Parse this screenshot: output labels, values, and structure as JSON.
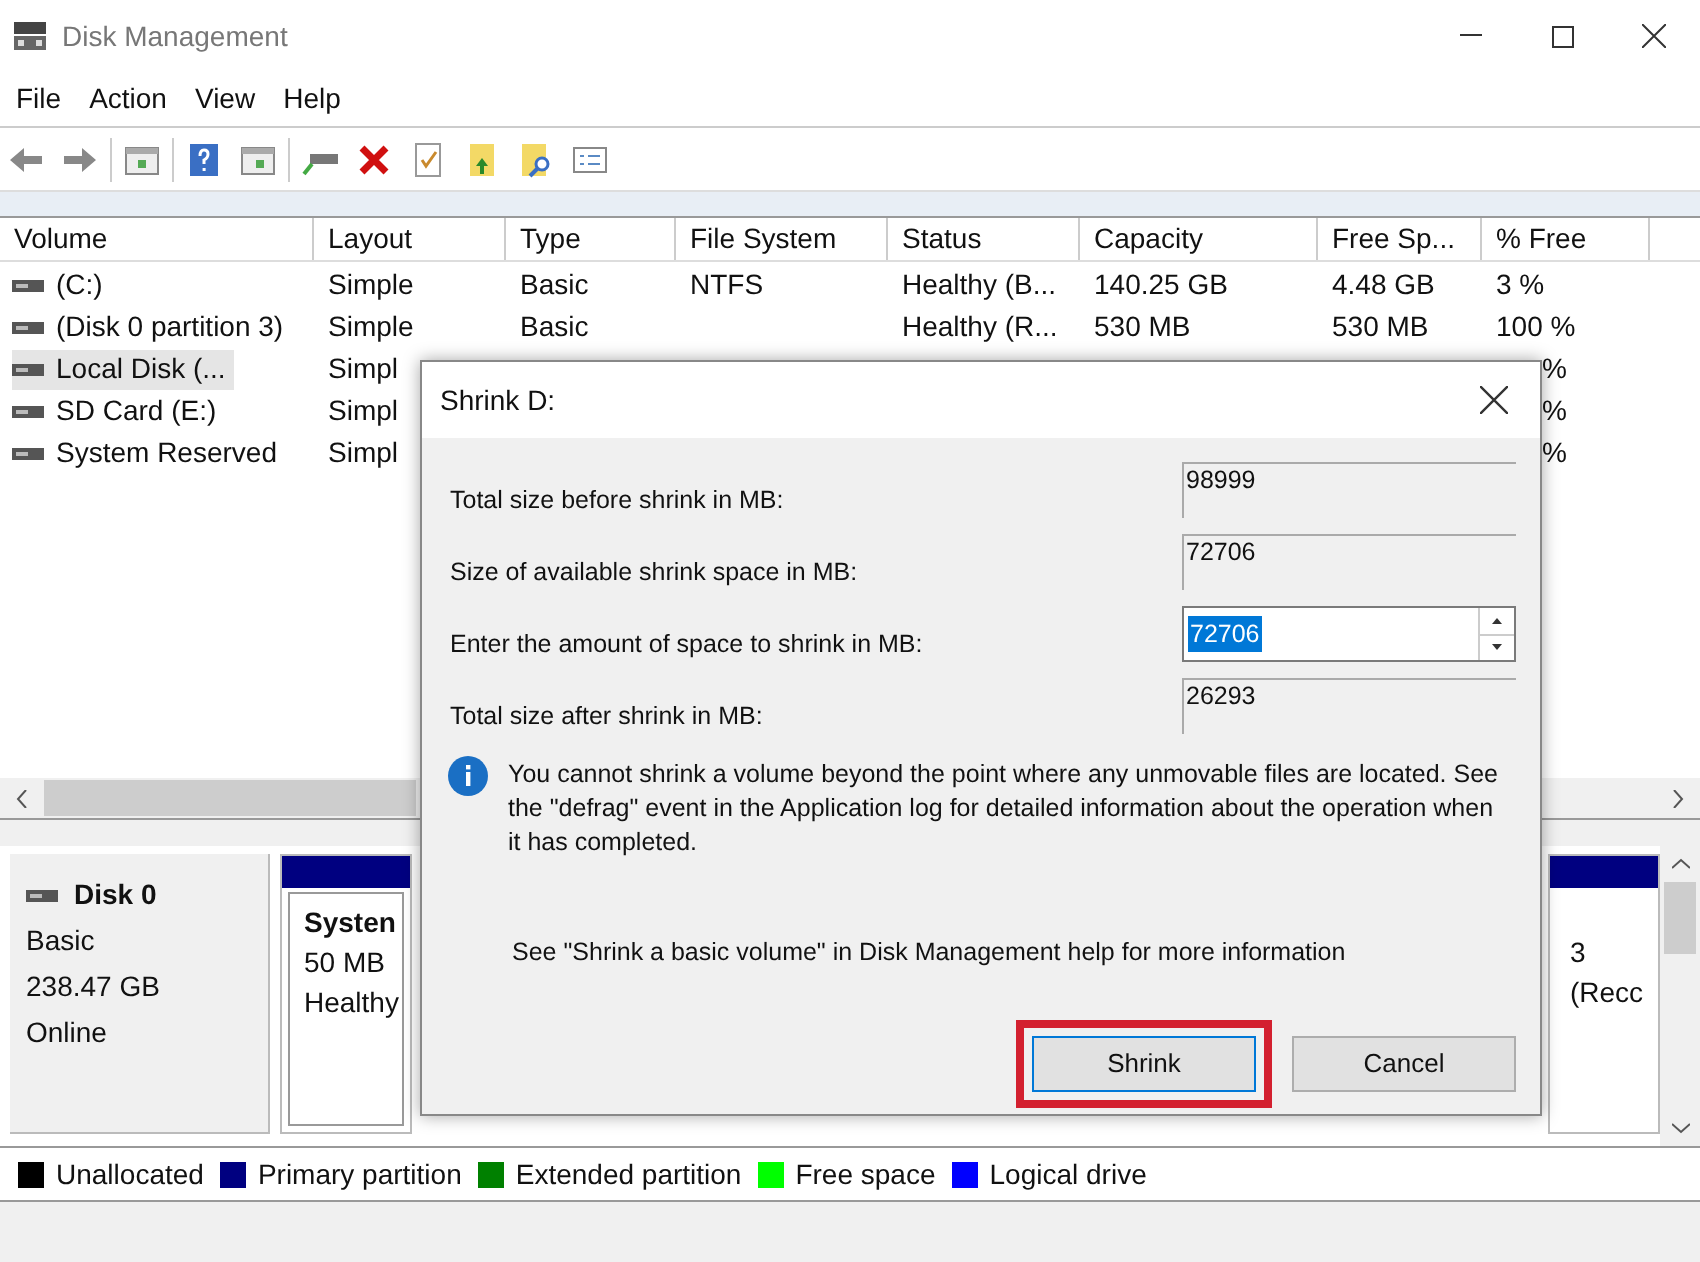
{
  "window": {
    "title": "Disk Management"
  },
  "menu": [
    "File",
    "Action",
    "View",
    "Help"
  ],
  "volumes": {
    "columns": [
      "Volume",
      "Layout",
      "Type",
      "File System",
      "Status",
      "Capacity",
      "Free Sp...",
      "% Free"
    ],
    "rows": [
      {
        "volume": "(C:)",
        "layout": "Simple",
        "type": "Basic",
        "file_system": "NTFS",
        "status": "Healthy (B...",
        "capacity": "140.25 GB",
        "free_space": "4.48 GB",
        "percent_free": "3 %",
        "selected": false
      },
      {
        "volume": "(Disk 0 partition 3)",
        "layout": "Simple",
        "type": "Basic",
        "status": "Healthy (R...",
        "capacity": "530 MB",
        "free_space": "530 MB",
        "percent_free": "100 %",
        "selected": false
      },
      {
        "volume": "Local Disk (...",
        "layout": "Simpl",
        "percent_free": "%",
        "selected": true,
        "partly_hidden": true
      },
      {
        "volume": "SD Card (E:)",
        "layout": "Simpl",
        "percent_free": "%",
        "selected": false,
        "partly_hidden": true
      },
      {
        "volume": "System Reserved",
        "layout": "Simpl",
        "percent_free": "%",
        "selected": false,
        "partly_hidden": true
      }
    ]
  },
  "disk": {
    "name": "Disk 0",
    "type": "Basic",
    "size": "238.47 GB",
    "status": "Online",
    "partitions": [
      {
        "lines": [
          "Systen",
          "50 MB",
          "Healthy"
        ]
      },
      {
        "lines": [
          "3",
          "(Recc"
        ]
      }
    ]
  },
  "legend": [
    {
      "label": "Unallocated",
      "color": "#000000"
    },
    {
      "label": "Primary partition",
      "color": "#000080"
    },
    {
      "label": "Extended partition",
      "color": "#008000"
    },
    {
      "label": "Free space",
      "color": "#00ff00"
    },
    {
      "label": "Logical drive",
      "color": "#0000ff"
    }
  ],
  "dialog": {
    "title": "Shrink D:",
    "fields": [
      {
        "label": "Total size before shrink in MB:",
        "value": "98999",
        "kind": "readonly"
      },
      {
        "label": "Size of available shrink space in MB:",
        "value": "72706",
        "kind": "readonly"
      },
      {
        "label": "Enter the amount of space to shrink in MB:",
        "value": "72706",
        "kind": "spin"
      },
      {
        "label": "Total size after shrink in MB:",
        "value": "26293",
        "kind": "readonly"
      }
    ],
    "info": "You cannot shrink a volume beyond the point where any unmovable files are located. See the \"defrag\" event in the Application log for detailed information about the operation when it has completed.",
    "help": "See \"Shrink a basic volume\" in Disk Management help for more information",
    "buttons": [
      {
        "label": "Shrink",
        "highlighted": true
      },
      {
        "label": "Cancel",
        "highlighted": false
      }
    ]
  }
}
